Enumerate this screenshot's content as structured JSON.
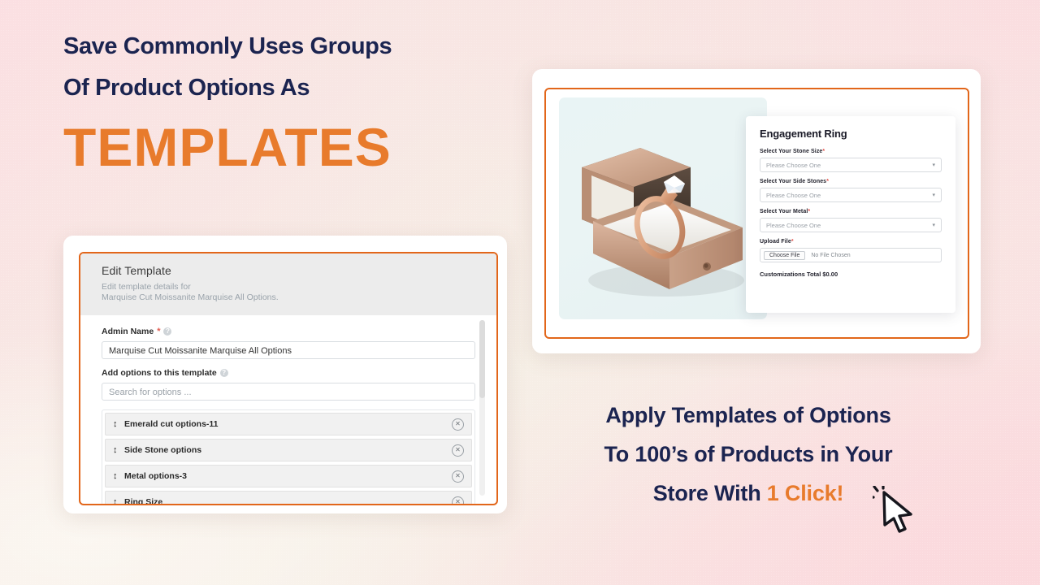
{
  "headline": {
    "line1": "Save Commonly Uses Groups",
    "line2": "Of Product Options As",
    "big": "TEMPLATES"
  },
  "tagline": {
    "line1": "Apply Templates of Options",
    "line2": "To 100’s of Products in Your",
    "line3_prefix": "Store With ",
    "line3_accent": "1 Click!"
  },
  "edit_template_card": {
    "title": "Edit Template",
    "subtitle_line1": "Edit template details for",
    "subtitle_line2": "Marquise Cut Moissanite Marquise All Options.",
    "admin_name": {
      "label": "Admin Name",
      "required_mark": "*",
      "help_icon": "question-icon",
      "value": "Marquise Cut Moissanite Marquise All Options"
    },
    "add_options": {
      "label": "Add options to this template",
      "help_icon": "question-icon",
      "placeholder": "Search for options ..."
    },
    "options": [
      {
        "name": "Emerald cut options-11",
        "drag_icon": "drag-handle-icon",
        "remove_icon": "remove-circle-icon"
      },
      {
        "name": "Side Stone options",
        "drag_icon": "drag-handle-icon",
        "remove_icon": "remove-circle-icon"
      },
      {
        "name": "Metal options-3",
        "drag_icon": "drag-handle-icon",
        "remove_icon": "remove-circle-icon"
      },
      {
        "name": "Ring Size",
        "drag_icon": "drag-handle-icon",
        "remove_icon": "remove-circle-icon"
      }
    ]
  },
  "product_preview": {
    "image_alt": "engagement-ring-in-box",
    "form": {
      "title": "Engagement Ring",
      "fields": [
        {
          "label": "Select Your Stone Size",
          "required_mark": "*",
          "value": "Please Choose One",
          "type": "select"
        },
        {
          "label": "Select Your Side Stones",
          "required_mark": "*",
          "value": "Please Choose One",
          "type": "select"
        },
        {
          "label": "Select Your Metal",
          "required_mark": "*",
          "value": "Please Choose One",
          "type": "select"
        }
      ],
      "upload": {
        "label": "Upload File",
        "required_mark": "*",
        "button_label": "Choose File",
        "file_status": "No File Chosen"
      },
      "total": "Customizations Total $0.00"
    }
  },
  "colors": {
    "navy": "#1b2450",
    "orange": "#e87b2c",
    "panel_border": "#e2661a",
    "required_red": "#e2504a"
  }
}
